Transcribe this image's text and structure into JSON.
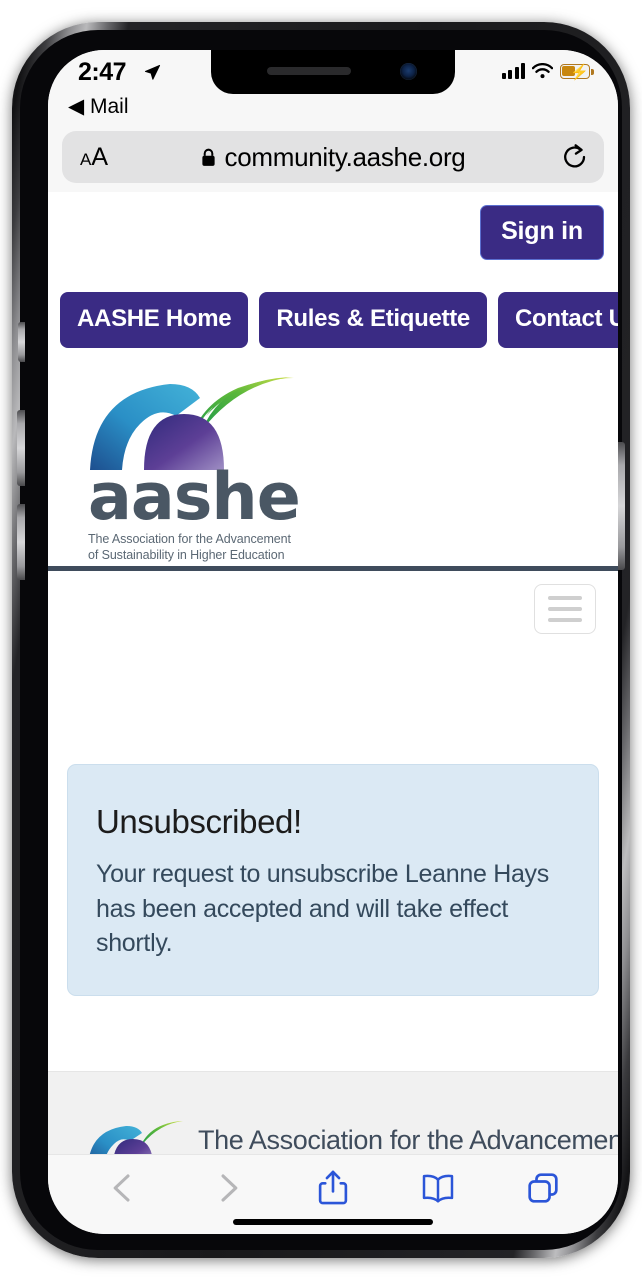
{
  "status_bar": {
    "time": "2:47",
    "location_icon": "location-arrow-icon",
    "signal_icon": "cellular-signal-icon",
    "wifi_icon": "wifi-icon",
    "battery_icon": "battery-charging-icon"
  },
  "back_to_app": {
    "label": "◀ Mail"
  },
  "browser": {
    "text_size_small": "A",
    "text_size_large": "A",
    "lock_icon": "lock-icon",
    "url": "community.aashe.org",
    "reload_icon": "reload-icon",
    "toolbar": {
      "back_icon": "chevron-left-icon",
      "forward_icon": "chevron-right-icon",
      "share_icon": "share-icon",
      "bookmarks_icon": "book-icon",
      "tabs_icon": "tabs-icon"
    }
  },
  "page": {
    "sign_in_label": "Sign in",
    "nav_buttons": [
      {
        "label": "AASHE Home"
      },
      {
        "label": "Rules & Etiquette"
      },
      {
        "label": "Contact Us"
      }
    ],
    "brand": {
      "wordmark": "aashe",
      "tagline_line1": "The Association for the Advancement",
      "tagline_line2": "of Sustainability in Higher Education",
      "logo_icon": "aashe-logo-icon"
    },
    "menu_toggle_icon": "hamburger-menu-icon",
    "alert": {
      "heading": "Unsubscribed!",
      "message": "Your request to unsubscribe Leanne Hays has been accepted and will take effect shortly."
    },
    "footer": {
      "logo_icon": "aashe-logo-icon",
      "tagline": "The Association for the Advancement"
    }
  },
  "colors": {
    "brand_purple": "#3a2b84",
    "alert_background": "#dbe9f4",
    "alert_text": "#34495c",
    "divider": "#3f4c5c",
    "safari_accent": "#2b55d8",
    "battery_charging": "#c8860d"
  }
}
